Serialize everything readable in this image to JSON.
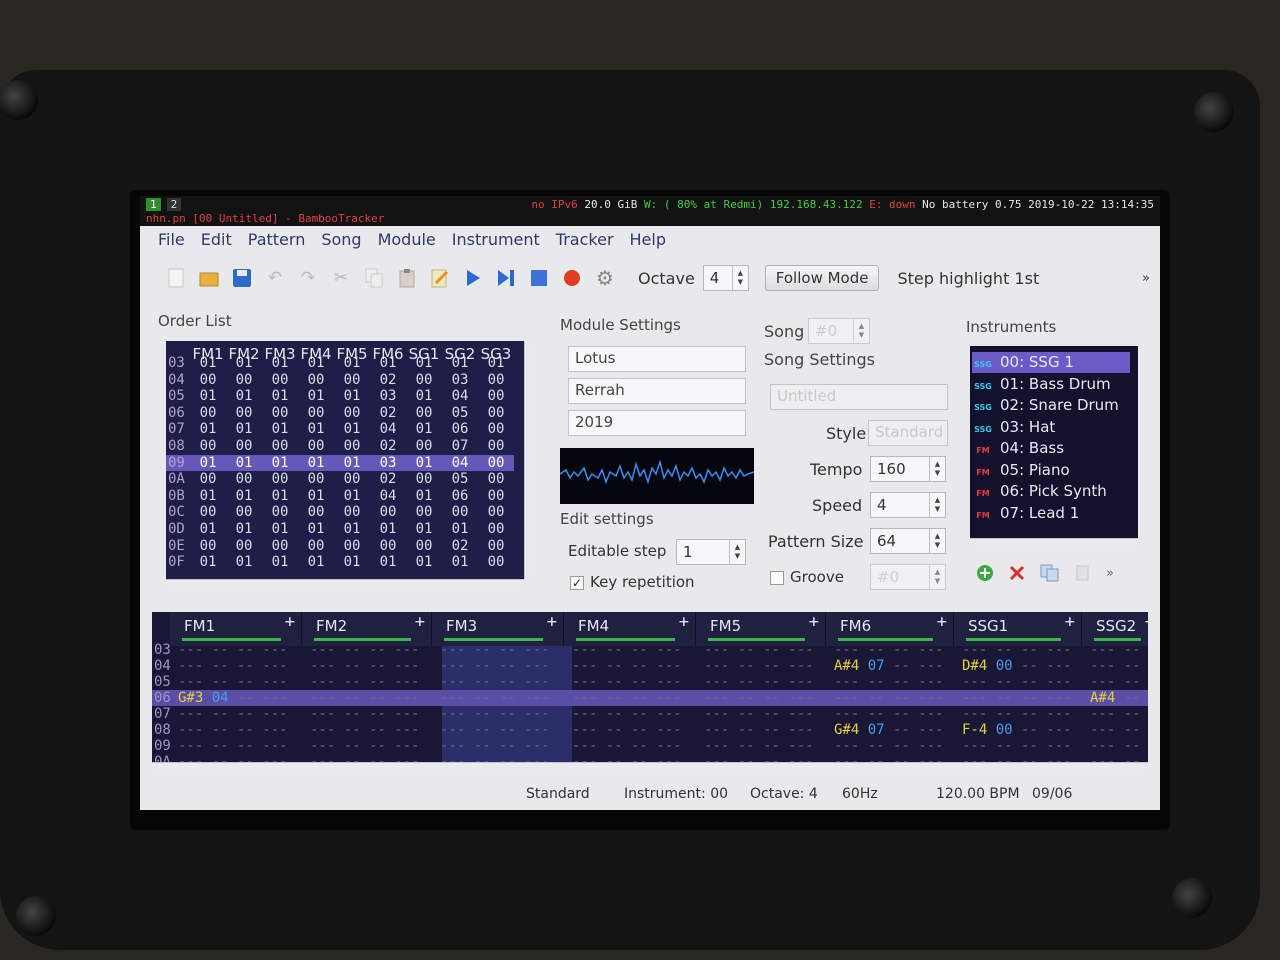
{
  "taskbar": {
    "ws1": "1",
    "ws2": "2",
    "net": "no IPv6",
    "disk": "20.0 GiB",
    "wifi": "W: ( 80% at Redmi) 192.168.43.122",
    "eth": "E: down",
    "battery": "No battery",
    "load": "0.75",
    "clock": "2019-10-22 13:14:35",
    "window_title": "nhn.pn [00 Untitled] - BambooTracker"
  },
  "menu": [
    "File",
    "Edit",
    "Pattern",
    "Song",
    "Module",
    "Instrument",
    "Tracker",
    "Help"
  ],
  "toolbar": {
    "icons": [
      "new-icon",
      "open-icon",
      "save-icon",
      "undo-icon",
      "redo-icon",
      "cut-icon",
      "copy-icon",
      "paste-icon",
      "edit-icon",
      "play-icon",
      "play-step-icon",
      "stop-icon",
      "record-icon",
      "settings-icon"
    ],
    "octave_label": "Octave",
    "octave_value": "4",
    "follow_mode": "Follow Mode",
    "step_highlight": "Step highlight 1st",
    "more": "»"
  },
  "order_list": {
    "title": "Order List",
    "channels": [
      "FM1",
      "FM2",
      "FM3",
      "FM4",
      "FM5",
      "FM6",
      "SG1",
      "SG2",
      "SG3"
    ],
    "rows": [
      {
        "n": "03",
        "v": [
          "01",
          "01",
          "01",
          "01",
          "01",
          "01",
          "01",
          "01",
          "01"
        ]
      },
      {
        "n": "04",
        "v": [
          "00",
          "00",
          "00",
          "00",
          "00",
          "02",
          "00",
          "03",
          "00"
        ]
      },
      {
        "n": "05",
        "v": [
          "01",
          "01",
          "01",
          "01",
          "01",
          "03",
          "01",
          "04",
          "00"
        ]
      },
      {
        "n": "06",
        "v": [
          "00",
          "00",
          "00",
          "00",
          "00",
          "02",
          "00",
          "05",
          "00"
        ]
      },
      {
        "n": "07",
        "v": [
          "01",
          "01",
          "01",
          "01",
          "01",
          "04",
          "01",
          "06",
          "00"
        ]
      },
      {
        "n": "08",
        "v": [
          "00",
          "00",
          "00",
          "00",
          "00",
          "02",
          "00",
          "07",
          "00"
        ]
      },
      {
        "n": "09",
        "v": [
          "01",
          "01",
          "01",
          "01",
          "01",
          "03",
          "01",
          "04",
          "00"
        ]
      },
      {
        "n": "0A",
        "v": [
          "00",
          "00",
          "00",
          "00",
          "00",
          "02",
          "00",
          "05",
          "00"
        ]
      },
      {
        "n": "0B",
        "v": [
          "01",
          "01",
          "01",
          "01",
          "01",
          "04",
          "01",
          "06",
          "00"
        ]
      },
      {
        "n": "0C",
        "v": [
          "00",
          "00",
          "00",
          "00",
          "00",
          "00",
          "00",
          "00",
          "00"
        ]
      },
      {
        "n": "0D",
        "v": [
          "01",
          "01",
          "01",
          "01",
          "01",
          "01",
          "01",
          "01",
          "00"
        ]
      },
      {
        "n": "0E",
        "v": [
          "00",
          "00",
          "00",
          "00",
          "00",
          "00",
          "00",
          "02",
          "00"
        ]
      },
      {
        "n": "0F",
        "v": [
          "01",
          "01",
          "01",
          "01",
          "01",
          "01",
          "01",
          "01",
          "00"
        ]
      }
    ],
    "highlight_index": 6
  },
  "module_settings": {
    "title": "Module Settings",
    "name": "Lotus",
    "author": "Rerrah",
    "copyright": "2019",
    "edit_settings": "Edit settings",
    "editable_step_label": "Editable step",
    "editable_step_value": "1",
    "key_repetition_label": "Key repetition",
    "key_repetition_checked": "✓"
  },
  "song": {
    "label": "Song",
    "value": "#0",
    "settings_title": "Song Settings",
    "title_field": "Untitled",
    "style_label": "Style",
    "style_value": "Standard",
    "tempo_label": "Tempo",
    "tempo_value": "160",
    "speed_label": "Speed",
    "speed_value": "4",
    "pattern_size_label": "Pattern Size",
    "pattern_size_value": "64",
    "groove_label": "Groove",
    "groove_value": "#0"
  },
  "instruments": {
    "title": "Instruments",
    "items": [
      {
        "type": "SSG",
        "label": "00: SSG 1"
      },
      {
        "type": "SSG",
        "label": "01: Bass Drum"
      },
      {
        "type": "SSG",
        "label": "02: Snare Drum"
      },
      {
        "type": "SSG",
        "label": "03: Hat"
      },
      {
        "type": "FM",
        "label": "04: Bass"
      },
      {
        "type": "FM",
        "label": "05: Piano"
      },
      {
        "type": "FM",
        "label": "06: Pick Synth"
      },
      {
        "type": "FM",
        "label": "07: Lead 1"
      }
    ],
    "selected_index": 0,
    "tool_icons": [
      "add-icon",
      "remove-icon",
      "clone-icon",
      "edit-icon"
    ],
    "more": "»"
  },
  "pattern": {
    "channels": [
      "FM1",
      "FM2",
      "FM3",
      "FM4",
      "FM5",
      "FM6",
      "SSG1",
      "SSG2"
    ],
    "rows": [
      "03",
      "04",
      "05",
      "06",
      "07",
      "08",
      "09",
      "0A"
    ],
    "highlight_row": "06",
    "notes": [
      {
        "row": "04",
        "ch": 5,
        "note": "A#4",
        "inst": "07"
      },
      {
        "row": "04",
        "ch": 6,
        "note": "D#4",
        "inst": "00"
      },
      {
        "row": "06",
        "ch": 0,
        "note": "G#3",
        "inst": "04"
      },
      {
        "row": "06",
        "ch": 7,
        "note": "A#4",
        "inst": ""
      },
      {
        "row": "08",
        "ch": 5,
        "note": "G#4",
        "inst": "07"
      },
      {
        "row": "08",
        "ch": 6,
        "note": "F-4",
        "inst": "00"
      }
    ]
  },
  "statusbar": {
    "style": "Standard",
    "instrument": "Instrument: 00",
    "octave": "Octave: 4",
    "rate": "60Hz",
    "bpm": "120.00 BPM",
    "position": "09/06"
  },
  "colors": {
    "order_bg": "#1e1e48",
    "highlight": "#6657b8",
    "note": "#e8d03c",
    "instrument_num": "#4a9cf0",
    "fm_tag": "#e83a3a",
    "ssg_tag": "#3ec8e8"
  }
}
